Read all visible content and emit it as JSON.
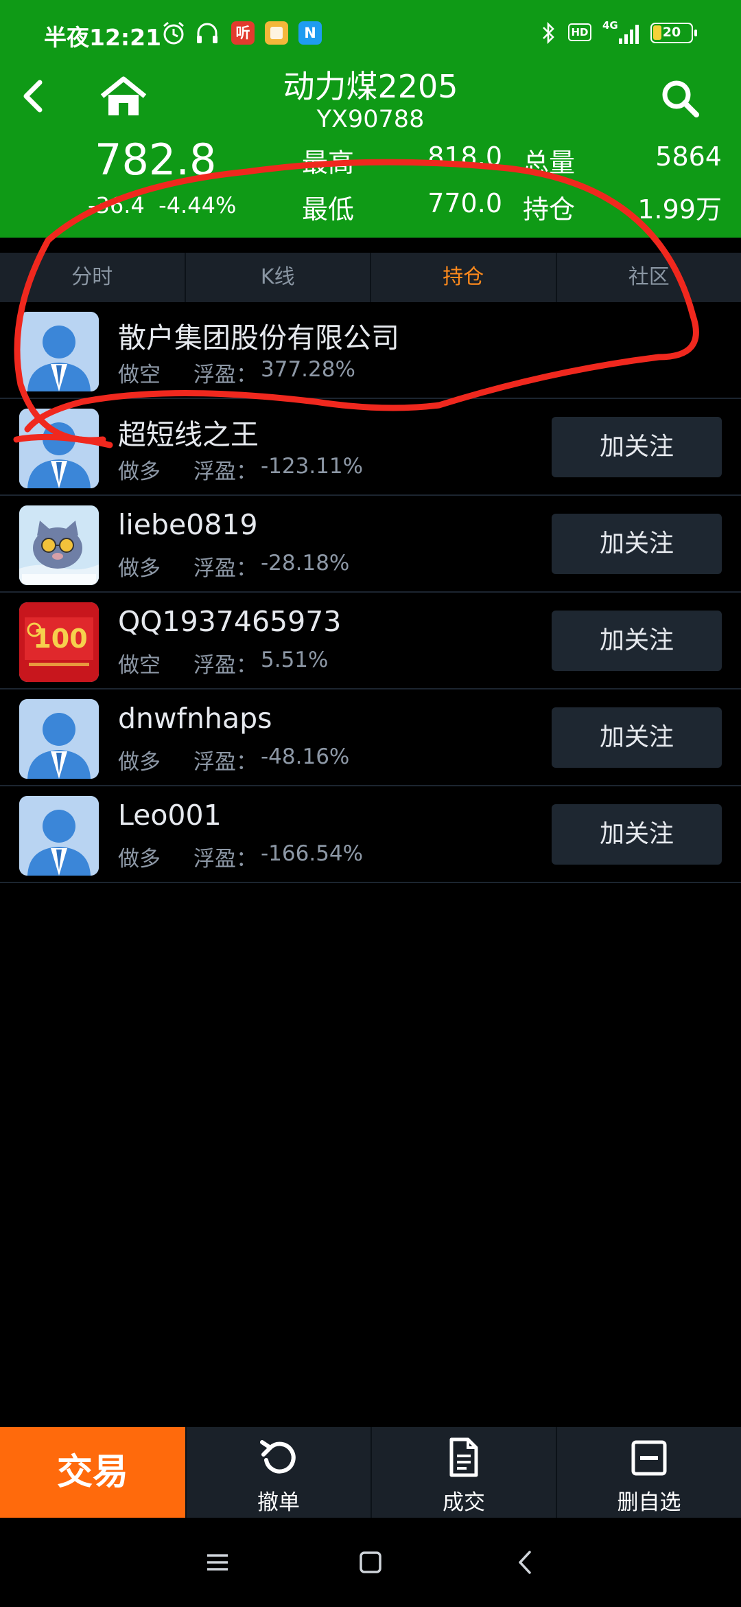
{
  "status_bar": {
    "time": "半夜12:21",
    "apps": [
      {
        "name": "ting-app-icon",
        "label": "听",
        "color": "#e23b2e"
      },
      {
        "name": "notes-app-icon",
        "label": "",
        "color": "#f4b73a"
      },
      {
        "name": "n-app-icon",
        "label": "N",
        "color": "#1f9cf0"
      }
    ],
    "network": "4G",
    "hd": "HD",
    "battery": "20"
  },
  "header": {
    "title": "动力煤2205",
    "code": "YX90788",
    "last_price": "782.8",
    "change": "-36.4",
    "change_pct": "-4.44%",
    "high_label": "最高",
    "high_value": "818.0",
    "low_label": "最低",
    "low_value": "770.0",
    "volume_label": "总量",
    "volume_value": "5864",
    "open_interest_label": "持仓",
    "open_interest_value": "1.99万"
  },
  "tabs": [
    {
      "label": "分时",
      "active": false
    },
    {
      "label": "K线",
      "active": false
    },
    {
      "label": "持仓",
      "active": true
    },
    {
      "label": "社区",
      "active": false
    }
  ],
  "positions": {
    "pnl_label": "浮盈：",
    "follow_label": "加关注",
    "rows": [
      {
        "name": "散户集团股份有限公司",
        "side": "做空",
        "pnl": "377.28%",
        "avatar": "default",
        "followable": false
      },
      {
        "name": "超短线之王",
        "side": "做多",
        "pnl": "-123.11%",
        "avatar": "default",
        "followable": true
      },
      {
        "name": "liebe0819",
        "side": "做多",
        "pnl": "-28.18%",
        "avatar": "cat",
        "followable": true
      },
      {
        "name": "QQ1937465973",
        "side": "做空",
        "pnl": "5.51%",
        "avatar": "red-emblem",
        "followable": true
      },
      {
        "name": "dnwfnhaps",
        "side": "做多",
        "pnl": "-48.16%",
        "avatar": "default",
        "followable": true
      },
      {
        "name": "Leo001",
        "side": "做多",
        "pnl": "-166.54%",
        "avatar": "default",
        "followable": true
      }
    ]
  },
  "bottom_bar": {
    "trade_label": "交易",
    "items": [
      {
        "label": "撤单",
        "icon": "undo-icon"
      },
      {
        "label": "成交",
        "icon": "document-icon"
      },
      {
        "label": "删自选",
        "icon": "remove-watchlist-icon"
      }
    ]
  },
  "colors": {
    "header_bg": "#0f9a16",
    "accent": "#ff8a1c",
    "trade_button": "#ff6a0c",
    "annotation": "#f0281e"
  }
}
